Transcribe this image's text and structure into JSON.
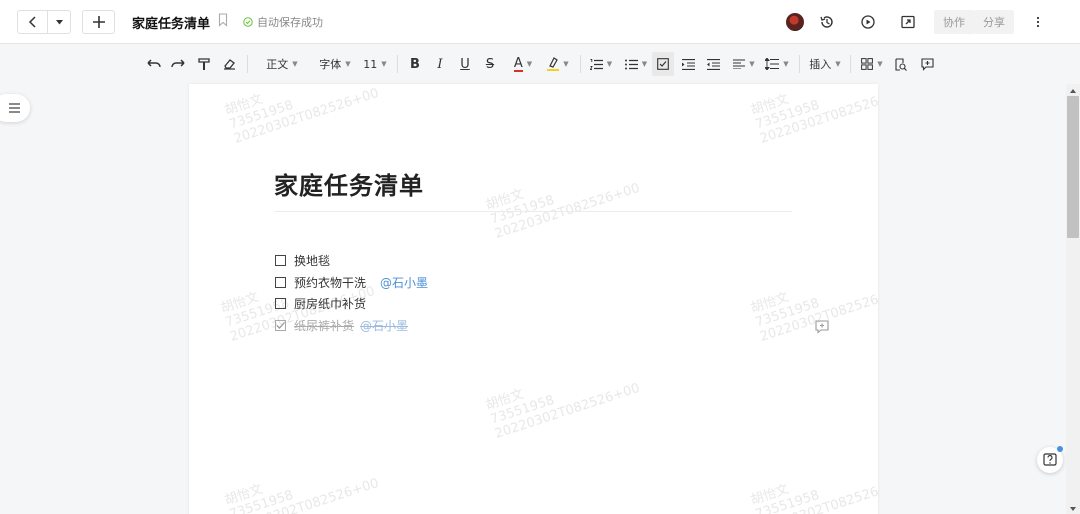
{
  "header": {
    "doc_title": "家庭任务清单",
    "autosave_status": "自动保存成功",
    "collab_label": "协作",
    "share_label": "分享"
  },
  "toolbar": {
    "style_label": "正文",
    "font_label": "字体",
    "size_label": "11",
    "insert_label": "插入"
  },
  "document": {
    "title": "家庭任务清单",
    "tasks": [
      {
        "text": "换地毯",
        "mention": "",
        "done": false
      },
      {
        "text": "预约衣物干洗",
        "mention": "@石小墨",
        "done": false
      },
      {
        "text": "厨房纸巾补货",
        "mention": "",
        "done": false
      },
      {
        "text": "纸尿裤补货",
        "mention": "@石小墨",
        "done": true
      }
    ]
  },
  "watermark": {
    "name": "胡怡文",
    "id": "73551958",
    "timestamp": "20220302T082526+00"
  },
  "colors": {
    "accent": "#4a8fd6",
    "page_bg": "#ffffff",
    "app_bg": "#f5f6f7"
  }
}
